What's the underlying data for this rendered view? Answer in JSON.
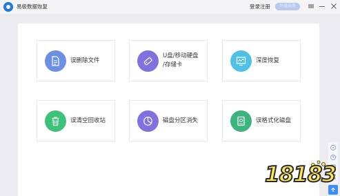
{
  "titlebar": {
    "app_title": "易极数据恢复",
    "login_link": "登录注册",
    "upgrade_button": "升级会员"
  },
  "cards": [
    {
      "label": "误删除文件",
      "icon": "file-doc-icon",
      "color": "#6b8fe3"
    },
    {
      "label": "U盘/移动硬盘\n/存储卡",
      "icon": "usb-drive-icon",
      "color": "#7f71e0"
    },
    {
      "label": "深度恢复",
      "icon": "monitor-wave-icon",
      "color": "#4fc1e6"
    },
    {
      "label": "误清空回收站",
      "icon": "trash-bin-icon",
      "color": "#3ec27a"
    },
    {
      "label": "磁盘分区消失",
      "icon": "pie-chart-icon",
      "color": "#7f71e0"
    },
    {
      "label": "误格式化磁盘",
      "icon": "disk-icon",
      "color": "#3db37e"
    }
  ],
  "watermark": {
    "text": "18183"
  },
  "colors": {
    "accent": "#3d8ff5",
    "upgrade_badge": "#b7c9ee",
    "watermark_fill": "#ffe45c"
  }
}
